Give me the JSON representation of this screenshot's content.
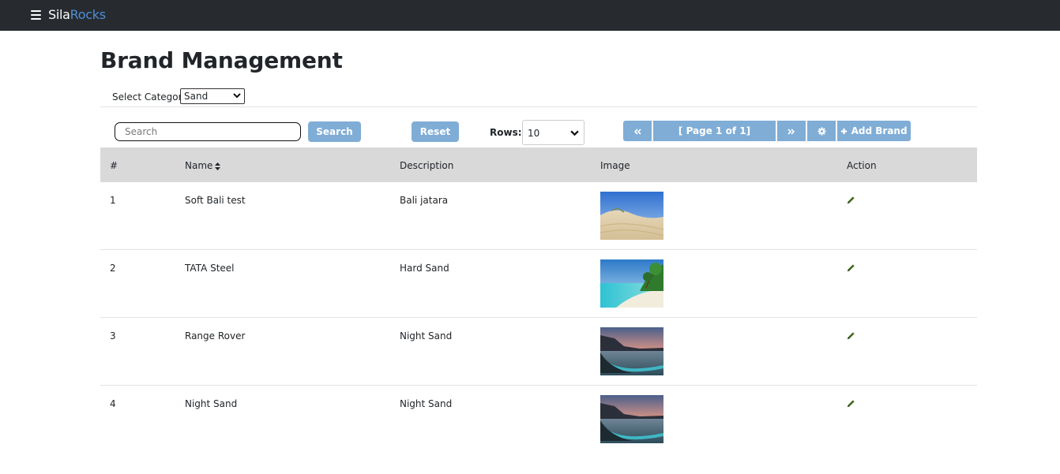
{
  "navbar": {
    "brand_part1": "Sila",
    "brand_part2": "Rocks",
    "menu_icon": "hamburger-icon",
    "brand_color": "#4e8fd6"
  },
  "page": {
    "title": "Brand Management"
  },
  "category": {
    "label": "Select Category",
    "selected": "Sand"
  },
  "toolbar": {
    "search_placeholder": "Search",
    "search_label": "Search",
    "reset_label": "Reset",
    "rows_label": "Rows:",
    "rows_value": "10",
    "first_icon": "double-left-chevron-icon",
    "page_info": "[ Page 1 of 1]",
    "next_icon": "double-right-chevron-icon",
    "settings_icon": "gear-icon",
    "add_label": "Add Brand",
    "add_icon": "plus-icon",
    "button_color": "#7fadd6"
  },
  "table": {
    "headers": {
      "index": "#",
      "name": "Name",
      "description": "Description",
      "image": "Image",
      "action": "Action"
    },
    "rows": [
      {
        "index": "1",
        "name": "Soft Bali test",
        "description": "Bali jatara",
        "image": "desert-dunes-photo",
        "action_icon": "pencil-icon"
      },
      {
        "index": "2",
        "name": "TATA Steel",
        "description": "Hard Sand",
        "image": "tropical-beach-photo",
        "action_icon": "pencil-icon"
      },
      {
        "index": "3",
        "name": "Range Rover",
        "description": "Night Sand",
        "image": "sunset-coast-photo",
        "action_icon": "pencil-icon"
      },
      {
        "index": "4",
        "name": "Night Sand",
        "description": "Night Sand",
        "image": "sunset-coast-photo",
        "action_icon": "pencil-icon"
      }
    ]
  }
}
